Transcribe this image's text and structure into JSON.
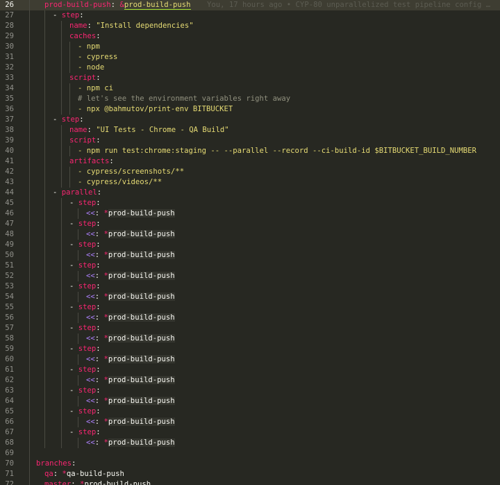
{
  "editor": {
    "blame": "You, 17 hours ago • CYP-80 unparallelized test pipeline config …",
    "lines": [
      {
        "n": "26",
        "parts": [
          {
            "t": "prod-build-push",
            "c": "key"
          },
          {
            "t": ": ",
            "c": "punct"
          },
          {
            "t": "&",
            "c": "anchor-sym"
          },
          {
            "t": "prod-build-push",
            "c": "anchor-name"
          }
        ]
      },
      {
        "n": "27",
        "parts": [
          {
            "t": "- ",
            "c": "punct"
          },
          {
            "t": "step",
            "c": "key"
          },
          {
            "t": ":",
            "c": "punct"
          }
        ]
      },
      {
        "n": "28",
        "parts": [
          {
            "t": "name",
            "c": "key"
          },
          {
            "t": ": ",
            "c": "punct"
          },
          {
            "t": "\"Install dependencies\"",
            "c": "str"
          }
        ]
      },
      {
        "n": "29",
        "parts": [
          {
            "t": "caches",
            "c": "key"
          },
          {
            "t": ":",
            "c": "punct"
          }
        ]
      },
      {
        "n": "30",
        "parts": [
          {
            "t": "- npm",
            "c": "str"
          }
        ]
      },
      {
        "n": "31",
        "parts": [
          {
            "t": "- cypress",
            "c": "str"
          }
        ]
      },
      {
        "n": "32",
        "parts": [
          {
            "t": "- node",
            "c": "str"
          }
        ]
      },
      {
        "n": "33",
        "parts": [
          {
            "t": "script",
            "c": "key"
          },
          {
            "t": ":",
            "c": "punct"
          }
        ]
      },
      {
        "n": "34",
        "parts": [
          {
            "t": "- npm ci",
            "c": "str"
          }
        ]
      },
      {
        "n": "35",
        "parts": [
          {
            "t": "# let's see the environment variables right away",
            "c": "comment"
          }
        ]
      },
      {
        "n": "36",
        "parts": [
          {
            "t": "- npx @bahmutov/print-env BITBUCKET",
            "c": "str"
          }
        ]
      },
      {
        "n": "37",
        "parts": [
          {
            "t": "- ",
            "c": "punct"
          },
          {
            "t": "step",
            "c": "key"
          },
          {
            "t": ":",
            "c": "punct"
          }
        ]
      },
      {
        "n": "38",
        "parts": [
          {
            "t": "name",
            "c": "key"
          },
          {
            "t": ": ",
            "c": "punct"
          },
          {
            "t": "\"UI Tests - Chrome - QA Build\"",
            "c": "str"
          }
        ]
      },
      {
        "n": "39",
        "parts": [
          {
            "t": "script",
            "c": "key"
          },
          {
            "t": ":",
            "c": "punct"
          }
        ]
      },
      {
        "n": "40",
        "parts": [
          {
            "t": "- npm run test:chrome:staging -- --parallel --record --ci-build-id $BITBUCKET_BUILD_NUMBER",
            "c": "str"
          }
        ]
      },
      {
        "n": "41",
        "parts": [
          {
            "t": "artifacts",
            "c": "key"
          },
          {
            "t": ":",
            "c": "punct"
          }
        ]
      },
      {
        "n": "42",
        "parts": [
          {
            "t": "- cypress/screenshots/**",
            "c": "str"
          }
        ]
      },
      {
        "n": "43",
        "parts": [
          {
            "t": "- cypress/videos/**",
            "c": "str"
          }
        ]
      },
      {
        "n": "44",
        "parts": [
          {
            "t": "- ",
            "c": "punct"
          },
          {
            "t": "parallel",
            "c": "key"
          },
          {
            "t": ":",
            "c": "punct"
          }
        ]
      },
      {
        "n": "45",
        "parts": [
          {
            "t": "- ",
            "c": "punct"
          },
          {
            "t": "step",
            "c": "key"
          },
          {
            "t": ":",
            "c": "punct"
          }
        ]
      },
      {
        "n": "46",
        "parts": [
          {
            "t": "<<",
            "c": "merge"
          },
          {
            "t": ": ",
            "c": "punct"
          },
          {
            "t": "*",
            "c": "alias-sym"
          },
          {
            "t": "prod-build-push",
            "c": "alias-name"
          }
        ]
      },
      {
        "n": "47",
        "parts": [
          {
            "t": "- ",
            "c": "punct"
          },
          {
            "t": "step",
            "c": "key"
          },
          {
            "t": ":",
            "c": "punct"
          }
        ]
      },
      {
        "n": "48",
        "parts": [
          {
            "t": "<<",
            "c": "merge"
          },
          {
            "t": ": ",
            "c": "punct"
          },
          {
            "t": "*",
            "c": "alias-sym"
          },
          {
            "t": "prod-build-push",
            "c": "alias-name"
          }
        ]
      },
      {
        "n": "49",
        "parts": [
          {
            "t": "- ",
            "c": "punct"
          },
          {
            "t": "step",
            "c": "key"
          },
          {
            "t": ":",
            "c": "punct"
          }
        ]
      },
      {
        "n": "50",
        "parts": [
          {
            "t": "<<",
            "c": "merge"
          },
          {
            "t": ": ",
            "c": "punct"
          },
          {
            "t": "*",
            "c": "alias-sym"
          },
          {
            "t": "prod-build-push",
            "c": "alias-name"
          }
        ]
      },
      {
        "n": "51",
        "parts": [
          {
            "t": "- ",
            "c": "punct"
          },
          {
            "t": "step",
            "c": "key"
          },
          {
            "t": ":",
            "c": "punct"
          }
        ]
      },
      {
        "n": "52",
        "parts": [
          {
            "t": "<<",
            "c": "merge"
          },
          {
            "t": ": ",
            "c": "punct"
          },
          {
            "t": "*",
            "c": "alias-sym"
          },
          {
            "t": "prod-build-push",
            "c": "alias-name"
          }
        ]
      },
      {
        "n": "53",
        "parts": [
          {
            "t": "- ",
            "c": "punct"
          },
          {
            "t": "step",
            "c": "key"
          },
          {
            "t": ":",
            "c": "punct"
          }
        ]
      },
      {
        "n": "54",
        "parts": [
          {
            "t": "<<",
            "c": "merge"
          },
          {
            "t": ": ",
            "c": "punct"
          },
          {
            "t": "*",
            "c": "alias-sym"
          },
          {
            "t": "prod-build-push",
            "c": "alias-name"
          }
        ]
      },
      {
        "n": "55",
        "parts": [
          {
            "t": "- ",
            "c": "punct"
          },
          {
            "t": "step",
            "c": "key"
          },
          {
            "t": ":",
            "c": "punct"
          }
        ]
      },
      {
        "n": "56",
        "parts": [
          {
            "t": "<<",
            "c": "merge"
          },
          {
            "t": ": ",
            "c": "punct"
          },
          {
            "t": "*",
            "c": "alias-sym"
          },
          {
            "t": "prod-build-push",
            "c": "alias-name"
          }
        ]
      },
      {
        "n": "57",
        "parts": [
          {
            "t": "- ",
            "c": "punct"
          },
          {
            "t": "step",
            "c": "key"
          },
          {
            "t": ":",
            "c": "punct"
          }
        ]
      },
      {
        "n": "58",
        "parts": [
          {
            "t": "<<",
            "c": "merge"
          },
          {
            "t": ": ",
            "c": "punct"
          },
          {
            "t": "*",
            "c": "alias-sym"
          },
          {
            "t": "prod-build-push",
            "c": "alias-name"
          }
        ]
      },
      {
        "n": "59",
        "parts": [
          {
            "t": "- ",
            "c": "punct"
          },
          {
            "t": "step",
            "c": "key"
          },
          {
            "t": ":",
            "c": "punct"
          }
        ]
      },
      {
        "n": "60",
        "parts": [
          {
            "t": "<<",
            "c": "merge"
          },
          {
            "t": ": ",
            "c": "punct"
          },
          {
            "t": "*",
            "c": "alias-sym"
          },
          {
            "t": "prod-build-push",
            "c": "alias-name"
          }
        ]
      },
      {
        "n": "61",
        "parts": [
          {
            "t": "- ",
            "c": "punct"
          },
          {
            "t": "step",
            "c": "key"
          },
          {
            "t": ":",
            "c": "punct"
          }
        ]
      },
      {
        "n": "62",
        "parts": [
          {
            "t": "<<",
            "c": "merge"
          },
          {
            "t": ": ",
            "c": "punct"
          },
          {
            "t": "*",
            "c": "alias-sym"
          },
          {
            "t": "prod-build-push",
            "c": "alias-name"
          }
        ]
      },
      {
        "n": "63",
        "parts": [
          {
            "t": "- ",
            "c": "punct"
          },
          {
            "t": "step",
            "c": "key"
          },
          {
            "t": ":",
            "c": "punct"
          }
        ]
      },
      {
        "n": "64",
        "parts": [
          {
            "t": "<<",
            "c": "merge"
          },
          {
            "t": ": ",
            "c": "punct"
          },
          {
            "t": "*",
            "c": "alias-sym"
          },
          {
            "t": "prod-build-push",
            "c": "alias-name"
          }
        ]
      },
      {
        "n": "65",
        "parts": [
          {
            "t": "- ",
            "c": "punct"
          },
          {
            "t": "step",
            "c": "key"
          },
          {
            "t": ":",
            "c": "punct"
          }
        ]
      },
      {
        "n": "66",
        "parts": [
          {
            "t": "<<",
            "c": "merge"
          },
          {
            "t": ": ",
            "c": "punct"
          },
          {
            "t": "*",
            "c": "alias-sym"
          },
          {
            "t": "prod-build-push",
            "c": "alias-name"
          }
        ]
      },
      {
        "n": "67",
        "parts": [
          {
            "t": "- ",
            "c": "punct"
          },
          {
            "t": "step",
            "c": "key"
          },
          {
            "t": ":",
            "c": "punct"
          }
        ]
      },
      {
        "n": "68",
        "parts": [
          {
            "t": "<<",
            "c": "merge"
          },
          {
            "t": ": ",
            "c": "punct"
          },
          {
            "t": "*",
            "c": "alias-sym"
          },
          {
            "t": "prod-build-push",
            "c": "alias-name"
          }
        ]
      },
      {
        "n": "69",
        "parts": []
      },
      {
        "n": "70",
        "parts": [
          {
            "t": "branches",
            "c": "key"
          },
          {
            "t": ":",
            "c": "punct"
          }
        ]
      },
      {
        "n": "71",
        "parts": [
          {
            "t": "qa",
            "c": "key"
          },
          {
            "t": ": ",
            "c": "punct"
          },
          {
            "t": "*",
            "c": "alias-sym"
          },
          {
            "t": "qa-build-push",
            "c": "plain"
          }
        ]
      },
      {
        "n": "72",
        "parts": [
          {
            "t": "master",
            "c": "key"
          },
          {
            "t": ": ",
            "c": "punct"
          },
          {
            "t": "*",
            "c": "alias-sym"
          },
          {
            "t": "prod-build-push",
            "c": "plain"
          }
        ]
      },
      {
        "n": "73",
        "parts": []
      }
    ]
  }
}
